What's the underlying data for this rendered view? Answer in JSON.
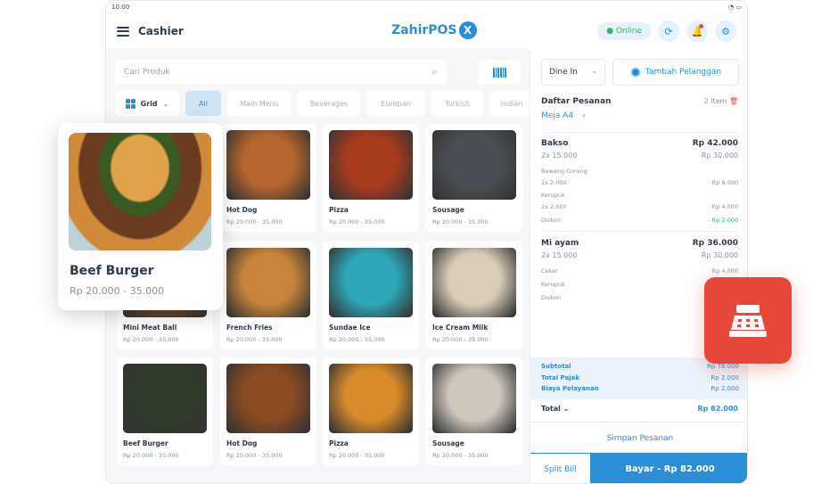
{
  "status_bar": {
    "time": "10:00"
  },
  "header": {
    "title": "Cashier",
    "logo": "ZahirPOS",
    "logo_mark": "X",
    "online": "Online"
  },
  "search": {
    "placeholder": "Cari Produk"
  },
  "view_select": "Grid",
  "categories": [
    "All",
    "Main Menu",
    "Beverages",
    "Europan",
    "Turkish",
    "Indian"
  ],
  "products": [
    {
      "name": "Hot Dog",
      "price": "Rp 20.000 - 35.000",
      "color": "#b5652e"
    },
    {
      "name": "Pizza",
      "price": "Rp 20.000 - 35.000",
      "color": "#a83a1e"
    },
    {
      "name": "Sousage",
      "price": "Rp 20.000 - 35.000",
      "color": "#4a4f55"
    },
    {
      "name": "Mini Meat Ball",
      "price": "Rp 20.000 - 35.000",
      "color": "#7a4a2a"
    },
    {
      "name": "French Fries",
      "price": "Rp 20.000 - 35.000",
      "color": "#c8843a"
    },
    {
      "name": "Sundae Ice",
      "price": "Rp 20.000 - 35.000",
      "color": "#2fa7b8"
    },
    {
      "name": "Ice Cream Milk",
      "price": "Rp 20.000 - 35.000",
      "color": "#d9cdb8"
    },
    {
      "name": "Beef Burger",
      "price": "Rp 20.000 - 35.000",
      "color": "#2f3b2a"
    },
    {
      "name": "Hot Dog",
      "price": "Rp 20.000 - 35.000",
      "color": "#8a4a22"
    },
    {
      "name": "Pizza",
      "price": "Rp 20.000 - 35.000",
      "color": "#d98a2a"
    },
    {
      "name": "Sousage",
      "price": "Rp 20.000 - 35.000",
      "color": "#cfc7bd"
    }
  ],
  "featured": {
    "name": "Beef Burger",
    "price": "Rp 20.000 - 35.000"
  },
  "order": {
    "type": "Dine In",
    "add_customer": "Tambah Pelanggan",
    "title": "Daftar Pesanan",
    "count": "2 Item",
    "table": "Meja A4",
    "items": [
      {
        "name": "Bakso",
        "total": "Rp 42.000",
        "qty": "2x 15.000",
        "base": "Rp 30.000",
        "addons": [
          {
            "name": "Bawang Goreng",
            "qty": "2x 2.000",
            "price": "Rp 8.000"
          },
          {
            "name": "Kerupuk",
            "qty": "2x 2.000",
            "price": "Rp 4.000"
          }
        ],
        "discount_label": "Diskon",
        "discount": "- Rp 2.000"
      },
      {
        "name": "Mi ayam",
        "total": "Rp 36.000",
        "qty": "2x 15.000",
        "base": "Rp 30.000",
        "ceker": "Ceker",
        "ceker_price": "Rp 4.000",
        "kerupuk": "Kerupuk",
        "discount_label": "Diskon"
      }
    ],
    "subtotal_label": "Subtotal",
    "subtotal": "Rp 78.000",
    "tax_label": "Total Pajak",
    "tax": "Rp 2.000",
    "service_label": "Biaya Pelayanan",
    "service": "Rp 2.000",
    "total_label": "Total",
    "total": "Rp 82.000",
    "save": "Simpan Pesanan",
    "split": "Split Bill",
    "pay": "Bayar - Rp 82.000"
  },
  "colors": {
    "accent": "#2a8fd6",
    "danger": "#e8483b",
    "success": "#2db46b"
  }
}
